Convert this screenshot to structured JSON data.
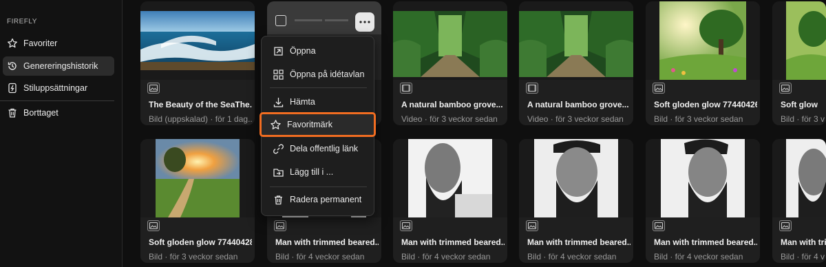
{
  "sidebar": {
    "section_label": "FIREFLY",
    "items": [
      {
        "label": "Favoriter",
        "icon": "star-icon"
      },
      {
        "label": "Genereringshistorik",
        "icon": "history-icon",
        "active": true
      },
      {
        "label": "Stiluppsättningar",
        "icon": "style-kit-icon"
      },
      {
        "label": "Borttaget",
        "icon": "trash-icon"
      }
    ]
  },
  "menu": {
    "items": [
      {
        "label": "Öppna",
        "icon": "open-external-icon"
      },
      {
        "label": "Öppna på idétavlan",
        "icon": "board-icon"
      },
      {
        "label": "Hämta",
        "icon": "download-icon"
      },
      {
        "label": "Favoritmärk",
        "icon": "star-icon",
        "highlighted": true
      },
      {
        "label": "Dela offentlig länk",
        "icon": "link-icon"
      },
      {
        "label": "Lägg till i ...",
        "icon": "add-to-folder-icon"
      },
      {
        "label": "Radera permanent",
        "icon": "trash-icon"
      }
    ]
  },
  "cards_row1": [
    {
      "title": "The Beauty of the SeaThe...",
      "meta": "Bild (uppskalad) · för 1 dag...",
      "type": "image",
      "thumb": "sea-waves"
    },
    {
      "title": "",
      "meta": "",
      "type": "image",
      "thumb": "hover-card"
    },
    {
      "title": "A natural bamboo grove...",
      "meta": "Video · för 3 veckor sedan",
      "type": "video",
      "thumb": "bamboo"
    },
    {
      "title": "A natural bamboo grove...",
      "meta": "Video · för 3 veckor sedan",
      "type": "video",
      "thumb": "bamboo"
    },
    {
      "title": "Soft gloden glow 77440426...",
      "meta": "Bild · för 3 veckor sedan",
      "type": "image",
      "thumb": "meadow-tree"
    },
    {
      "title": "Soft glow",
      "meta": "Bild · för 3 v",
      "type": "image",
      "thumb": "meadow-tree"
    }
  ],
  "cards_row2": [
    {
      "title": "Soft gloden glow 77440428...",
      "meta": "Bild · för 3 veckor sedan",
      "type": "image",
      "thumb": "sunset-path"
    },
    {
      "title": "Man with trimmed beared...",
      "meta": "Bild · för 4 veckor sedan",
      "type": "image",
      "thumb": "bearded-man"
    },
    {
      "title": "Man with trimmed beared...",
      "meta": "Bild · för 4 veckor sedan",
      "type": "image",
      "thumb": "bearded-man"
    },
    {
      "title": "Man with trimmed beared...",
      "meta": "Bild · för 4 veckor sedan",
      "type": "image",
      "thumb": "bearded-man"
    },
    {
      "title": "Man with trimmed beared...",
      "meta": "Bild · för 4 veckor sedan",
      "type": "image",
      "thumb": "bearded-man"
    },
    {
      "title": "Man with trim",
      "meta": "Bild · för 4 v",
      "type": "image",
      "thumb": "bearded-man"
    }
  ],
  "colors": {
    "highlight_outline": "#f26d21",
    "sidebar_active": "#2c2c2c"
  }
}
